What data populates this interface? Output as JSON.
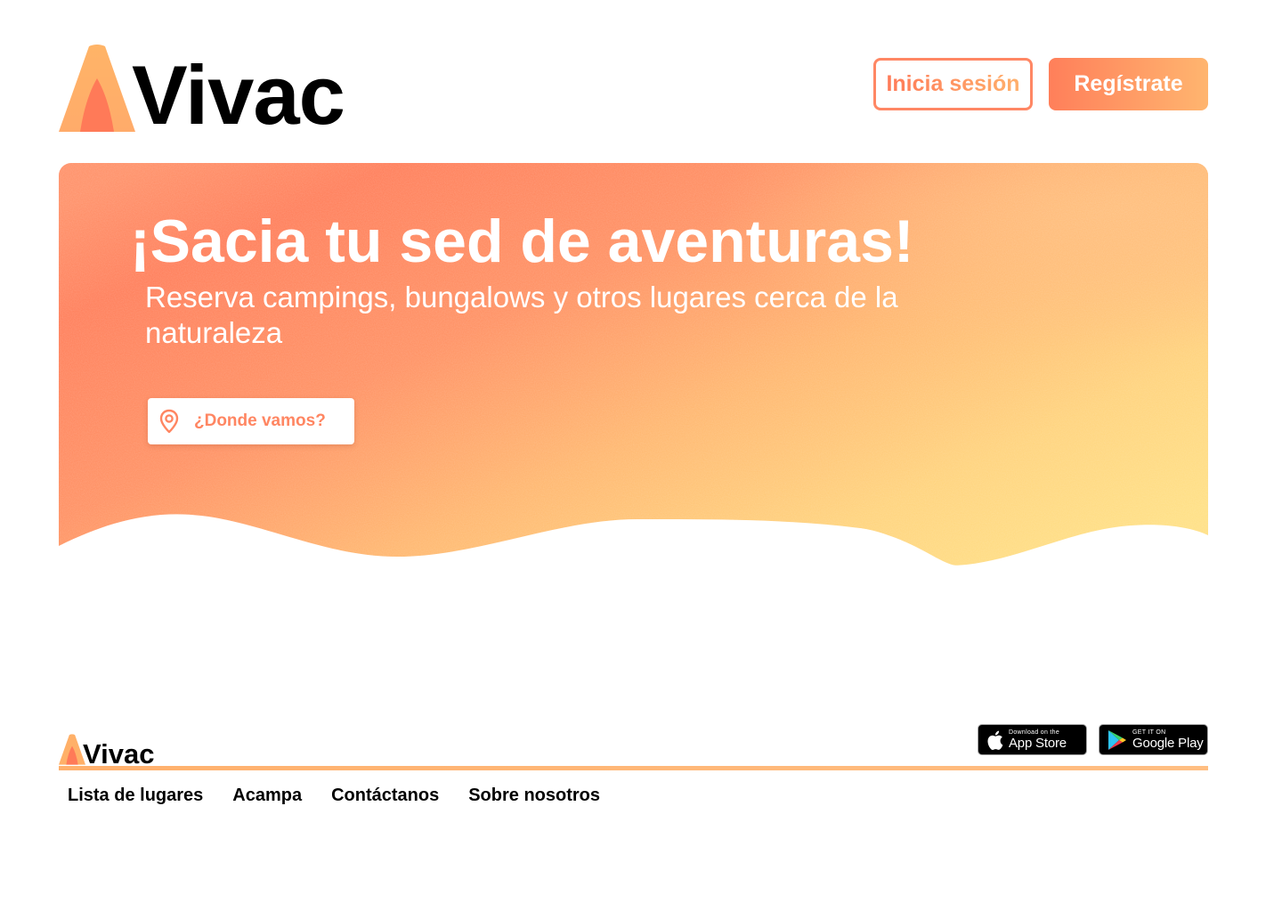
{
  "brand": {
    "name": "Vivac",
    "logo_icon": "tent-icon",
    "colors": {
      "primary": "#ff7a58",
      "secondary": "#ffb56f",
      "accent_yellow": "#ffde7d"
    }
  },
  "header": {
    "login_label": "Inicia sesión",
    "register_label": "Regístrate"
  },
  "hero": {
    "title": "¡Sacia tu sed de aventuras!",
    "subtitle": "Reserva campings, bungalows y otros lugares cerca de la naturaleza",
    "search": {
      "icon": "location-pin-icon",
      "placeholder": "¿Donde vamos?"
    }
  },
  "footer": {
    "brand_name": "Vivac",
    "app_store": {
      "small": "Download on the",
      "big": "App Store",
      "icon": "apple-icon"
    },
    "google_play": {
      "small": "GET IT ON",
      "big": "Google Play",
      "icon": "play-triangle-icon"
    },
    "links": [
      "Lista de lugares",
      "Acampa",
      "Contáctanos",
      "Sobre nosotros"
    ]
  }
}
